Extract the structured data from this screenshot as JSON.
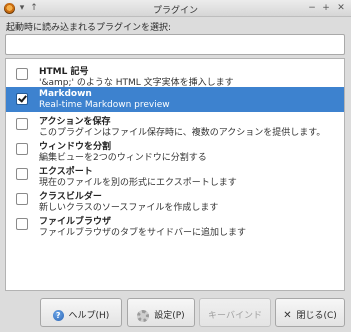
{
  "window": {
    "title": "プラグイン",
    "menu_glyph": "▾",
    "up_glyph": "↑",
    "minimize_glyph": "−",
    "maximize_glyph": "+",
    "close_glyph": "✕"
  },
  "prompt": "起動時に読み込まれるプラグインを選択:",
  "search": {
    "value": "",
    "placeholder": ""
  },
  "plugins": [
    {
      "name": "HTML 記号",
      "desc": "'&amp;' のような HTML 文字実体を挿入します",
      "checked": false,
      "selected": false
    },
    {
      "name": "Markdown",
      "desc": "Real-time Markdown preview",
      "checked": true,
      "selected": true
    },
    {
      "name": "アクションを保存",
      "desc": "このプラグインはファイル保存時に、複数のアクションを提供します。",
      "checked": false,
      "selected": false
    },
    {
      "name": "ウィンドウを分割",
      "desc": "編集ビューを2つのウィンドウに分割する",
      "checked": false,
      "selected": false
    },
    {
      "name": "エクスポート",
      "desc": "現在のファイルを別の形式にエクスポートします",
      "checked": false,
      "selected": false
    },
    {
      "name": "クラスビルダー",
      "desc": "新しいクラスのソースファイルを作成します",
      "checked": false,
      "selected": false
    },
    {
      "name": "ファイルブラウザ",
      "desc": "ファイルブラウザのタブをサイドバーに追加します",
      "checked": false,
      "selected": false
    }
  ],
  "buttons": {
    "help": "ヘルプ(H)",
    "help_glyph": "?",
    "settings": "設定(P)",
    "keybind": "キーバインド",
    "close": "閉じる(C)",
    "close_glyph": "✕"
  },
  "colors": {
    "selection": "#3d82cf",
    "window_bg": "#dcdcdc"
  }
}
